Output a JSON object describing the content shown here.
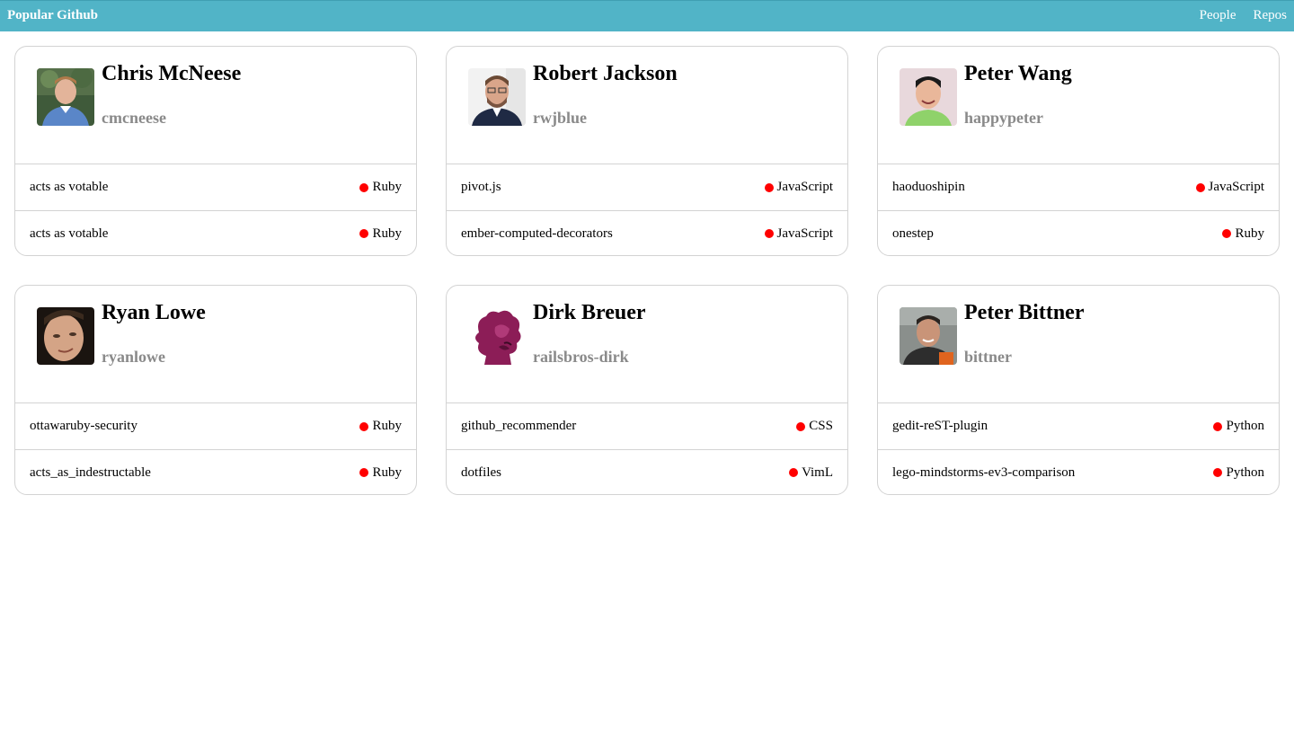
{
  "navbar": {
    "brand": "Popular Github",
    "links": [
      "People",
      "Repos"
    ]
  },
  "colors": {
    "navbar": "#51b4c7",
    "language_dot": "#ff0000",
    "login_text": "#8a8a8a",
    "border": "#d3d3d3"
  },
  "users": [
    {
      "name": "Chris McNeese",
      "login": "cmcneese",
      "avatar": "photo-icon",
      "repos": [
        {
          "name": "acts as votable",
          "language": "Ruby"
        },
        {
          "name": "acts as votable",
          "language": "Ruby"
        }
      ]
    },
    {
      "name": "Robert Jackson",
      "login": "rwjblue",
      "avatar": "photo-icon",
      "repos": [
        {
          "name": "pivot.js",
          "language": "JavaScript"
        },
        {
          "name": "ember-computed-decorators",
          "language": "JavaScript"
        }
      ]
    },
    {
      "name": "Peter Wang",
      "login": "happypeter",
      "avatar": "photo-icon",
      "repos": [
        {
          "name": "haoduoshipin",
          "language": "JavaScript"
        },
        {
          "name": "onestep",
          "language": "Ruby"
        }
      ]
    },
    {
      "name": "Ryan Lowe",
      "login": "ryanlowe",
      "avatar": "photo-icon",
      "repos": [
        {
          "name": "ottawaruby-security",
          "language": "Ruby"
        },
        {
          "name": "acts_as_indestructable",
          "language": "Ruby"
        }
      ]
    },
    {
      "name": "Dirk Breuer",
      "login": "railsbros-dirk",
      "avatar": "pony-silhouette-icon",
      "repos": [
        {
          "name": "github_recommender",
          "language": "CSS"
        },
        {
          "name": "dotfiles",
          "language": "VimL"
        }
      ]
    },
    {
      "name": "Peter Bittner",
      "login": "bittner",
      "avatar": "photo-icon",
      "repos": [
        {
          "name": "gedit-reST-plugin",
          "language": "Python"
        },
        {
          "name": "lego-mindstorms-ev3-comparison",
          "language": "Python"
        }
      ]
    }
  ]
}
